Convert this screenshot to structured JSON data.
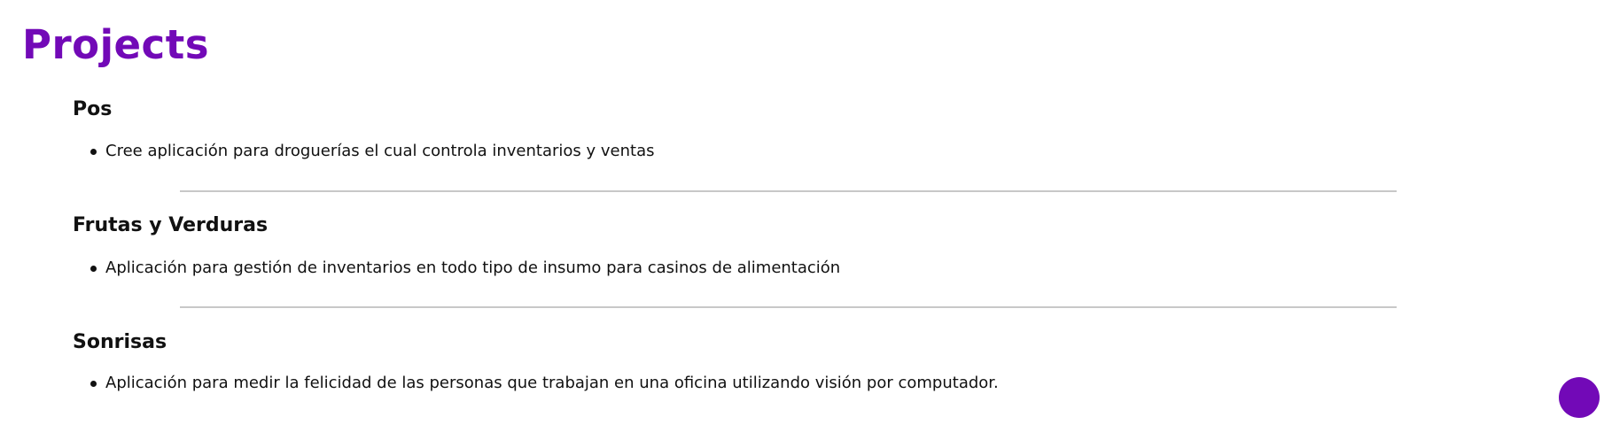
{
  "section": {
    "title": "Projects"
  },
  "projects": [
    {
      "name": "Pos",
      "items": [
        "Cree aplicación para droguerías el cual controla inventarios y ventas"
      ]
    },
    {
      "name": "Frutas y Verduras",
      "items": [
        "Aplicación para gestión de inventarios en todo tipo de insumo para casinos de alimentación"
      ]
    },
    {
      "name": "Sonrisas",
      "items": [
        "Aplicación para medir la felicidad de las personas que trabajan en una oficina utilizando visión por computador."
      ]
    }
  ],
  "colors": {
    "accent": "#7209b7",
    "text": "#111111",
    "divider": "#c8c8c8"
  },
  "fab": {
    "icon": "circle-icon"
  }
}
